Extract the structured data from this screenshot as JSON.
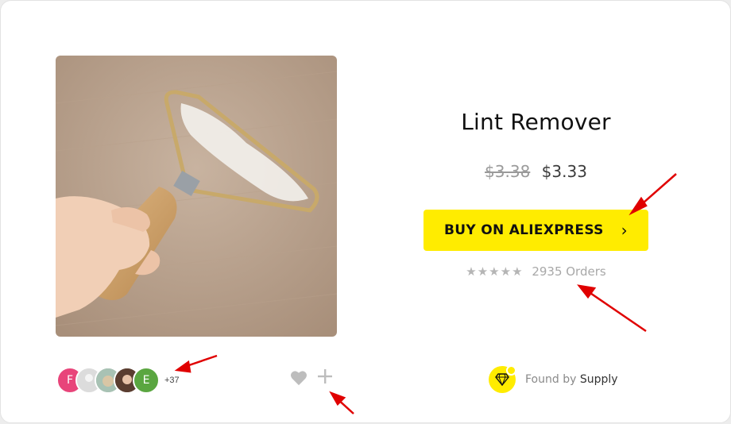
{
  "product": {
    "title": "Lint Remover",
    "price_old": "$3.38",
    "price_new": "$3.33",
    "buy_label": "BUY ON ALIEXPRESS",
    "buy_icon": "chevron-right-icon",
    "stars": "★★★★★",
    "rating_out_of_5": 5,
    "orders": "2935 Orders"
  },
  "social": {
    "avatar_f_initial": "F",
    "avatar_e_initial": "E",
    "more_count": "+37"
  },
  "actions": {
    "like_icon": "heart-icon",
    "add_icon": "plus-icon"
  },
  "found_by": {
    "prefix": "Found by",
    "brand": "Supply",
    "icon": "diamond-icon"
  },
  "colors": {
    "accent": "#ffec00",
    "annotation_arrow": "#e00000"
  }
}
